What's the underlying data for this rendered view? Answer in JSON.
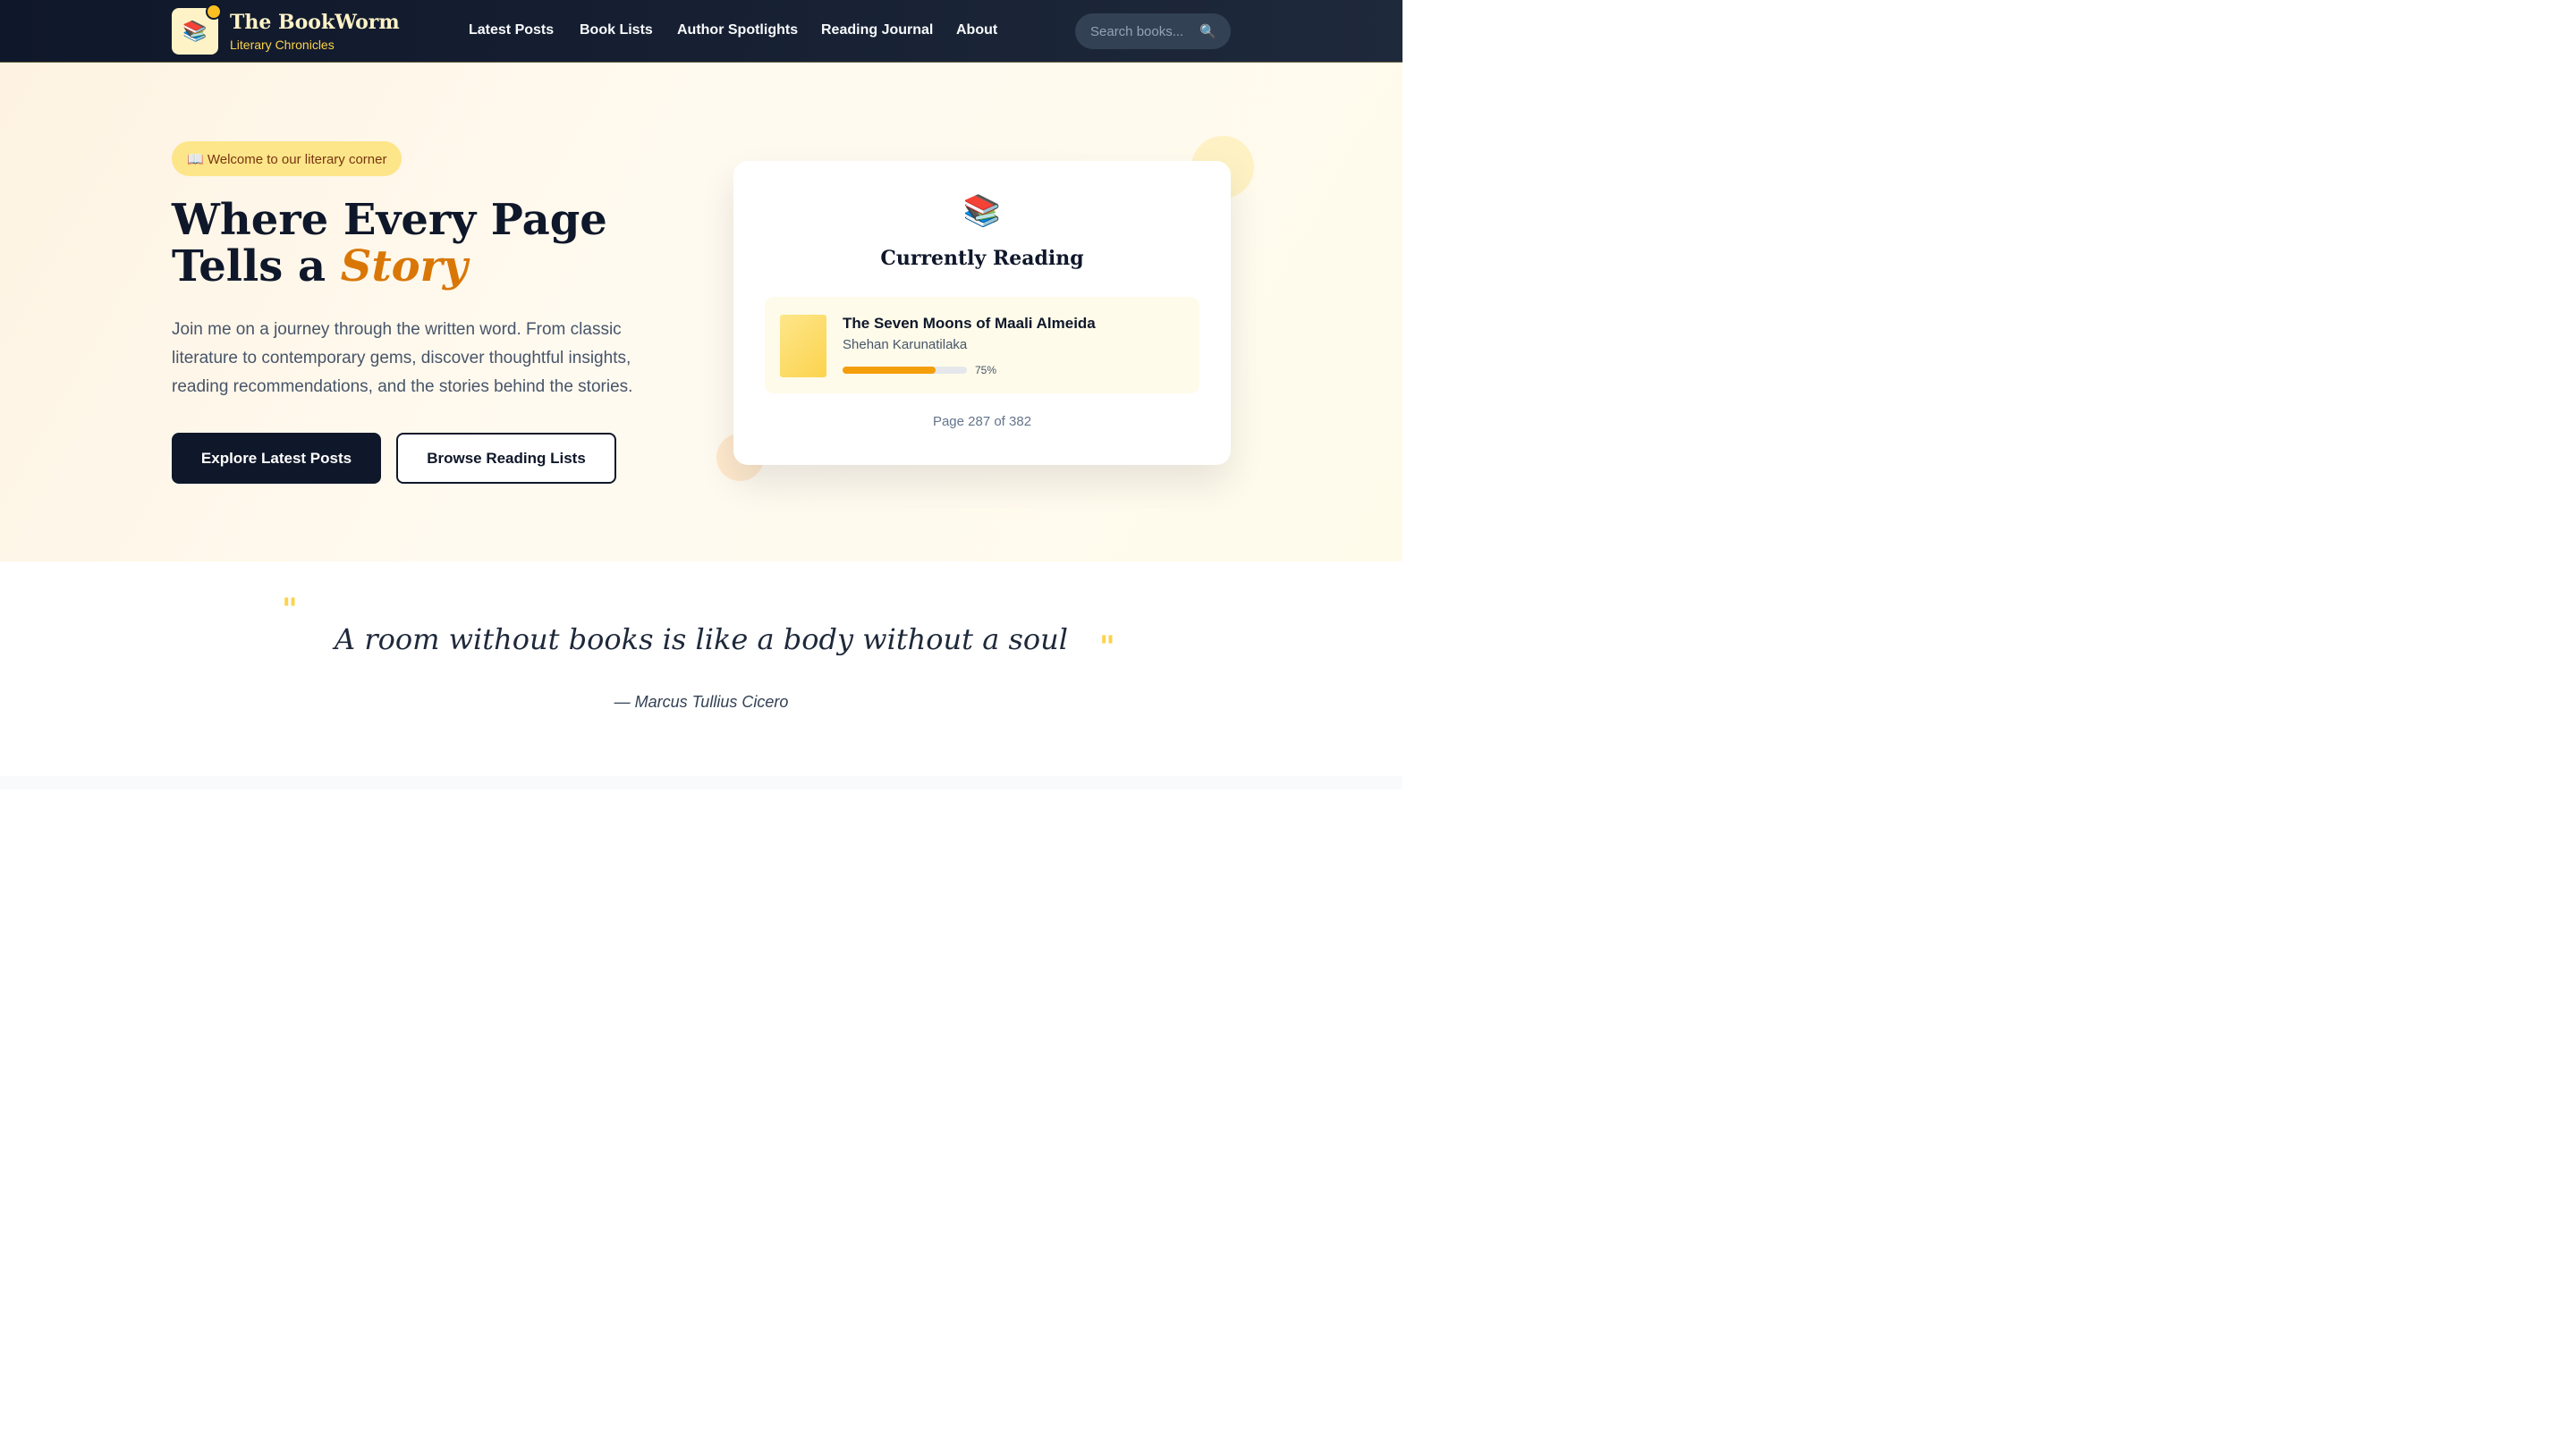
{
  "nav": {
    "brand_title": "The BookWorm",
    "brand_subtitle": "Literary Chronicles",
    "logo_icon": "📚",
    "links": [
      "Latest Posts",
      "Book Lists",
      "Author Spotlights",
      "Reading Journal",
      "About"
    ],
    "search_placeholder": "Search books...",
    "search_icon": "🔍"
  },
  "hero": {
    "badge": "📖 Welcome to our literary corner",
    "headline_line1": "Where Every Page",
    "headline_line2_prefix": "Tells a",
    "headline_accent": "Story",
    "lead": "Join me on a journey through the written word. From classic literature to contemporary gems, discover thoughtful insights, reading recommendations, and the stories behind the stories.",
    "primary_button": "Explore Latest Posts",
    "secondary_button": "Browse Reading Lists"
  },
  "reading_card": {
    "icon": "📚",
    "title": "Currently Reading",
    "book_title": "The Seven Moons of Maali Almeida",
    "book_author": "Shehan Karunatilaka",
    "progress": 0.75,
    "progress_label": "75%",
    "page_status": "Page 287 of 382"
  },
  "quote": {
    "open_mark": "\"",
    "close_mark": "\"",
    "text": "A room without books is like a body without a soul",
    "author": "— Marcus Tullius Cicero"
  },
  "colors": {
    "nav_bg": "#0f172a",
    "accent": "#d97706",
    "highlight": "#fcd34d",
    "progress": "#f59e0b"
  }
}
